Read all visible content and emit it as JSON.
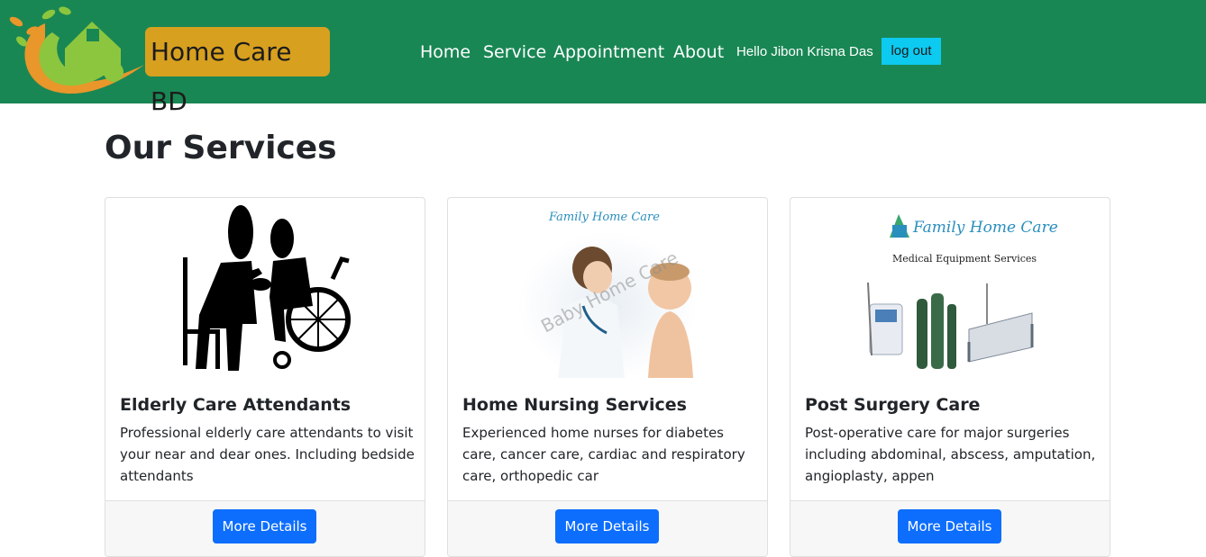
{
  "header": {
    "brand": "Home Care BD",
    "nav": [
      "Home",
      "Service",
      "Appointment",
      "About"
    ],
    "greeting": "Hello Jibon Krisna Das",
    "logout_label": "log out",
    "colors": {
      "navbar": "#198754",
      "brand_bg": "#d8a01f",
      "logout_bg": "#0dcaf0"
    }
  },
  "main": {
    "title": "Our Services",
    "cards": [
      {
        "image": "elderly-care-icon",
        "title": "Elderly Care Attendants",
        "text": "Professional elderly care attendants to visit your near and dear ones. Including bedside attendants",
        "button": "More Details"
      },
      {
        "image": "home-nursing-photo",
        "image_caption": "Family Home Care",
        "image_watermark": "Baby Home Care",
        "title": "Home Nursing Services",
        "text": "Experienced home nurses for diabetes care, cancer care, cardiac and respiratory care, orthopedic car",
        "button": "More Details"
      },
      {
        "image": "medical-equipment-photo",
        "image_caption": "Family Home Care",
        "image_subcaption": "Medical Equipment Services",
        "title": "Post Surgery Care",
        "text": "Post-operative care for major surgeries including abdominal, abscess, amputation, angioplasty, appen",
        "button": "More Details"
      }
    ],
    "colors": {
      "button": "#0d6efd"
    }
  }
}
